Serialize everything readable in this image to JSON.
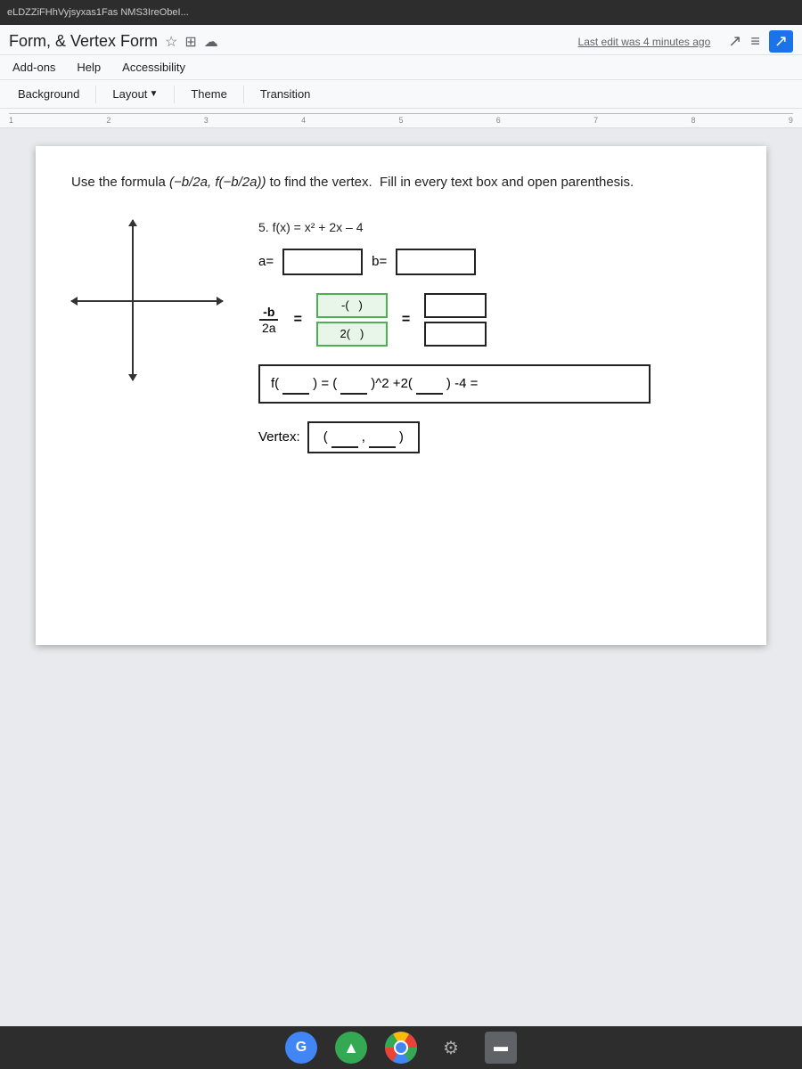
{
  "topbar": {
    "text": "eLDZZiFHhVyjsyxas1Fas NMS3IreObeI..."
  },
  "titlebar": {
    "title": "Form, & Vertex Form",
    "last_edit": "Last edit was 4 minutes ago",
    "star_icon": "☆",
    "monitor_icon": "⊞",
    "cloud_icon": "☁"
  },
  "menubar": {
    "items": [
      "Add-ons",
      "Help",
      "Accessibility"
    ]
  },
  "toolbar": {
    "items": [
      "Background",
      "Layout",
      "Theme",
      "Transition"
    ]
  },
  "ruler": {
    "marks": [
      "1",
      "2",
      "3",
      "4",
      "5",
      "6",
      "7",
      "8",
      "9"
    ]
  },
  "slide": {
    "instructions": "Use the formula (-b/2a, f(-b/2a)) to find the vertex.  Fill in every text box and open parenthesis.",
    "problem_number": "5.",
    "problem_function": "f(x) = x² + 2x – 4",
    "ab_row": {
      "a_label": "a=",
      "b_label": "b="
    },
    "fraction_label_num": "-b",
    "fraction_label_den": "2a",
    "frac_top_content": "-( )",
    "frac_bottom_content": "2( )",
    "fx_expression": "f(   ) = (   )^2 +2(   ) -4 =",
    "vertex_label": "Vertex:",
    "vertex_content": "(    ,    )"
  },
  "taskbar": {
    "icons": [
      {
        "name": "google-launcher",
        "symbol": "G",
        "color": "#4285f4"
      },
      {
        "name": "google-slides",
        "symbol": "▲",
        "color": "#34a853"
      },
      {
        "name": "chrome",
        "symbol": "⬤",
        "color": "#ea4335"
      },
      {
        "name": "settings",
        "symbol": "⚙",
        "color": "#aaa"
      },
      {
        "name": "files",
        "symbol": "▬",
        "color": "#fff"
      }
    ]
  }
}
